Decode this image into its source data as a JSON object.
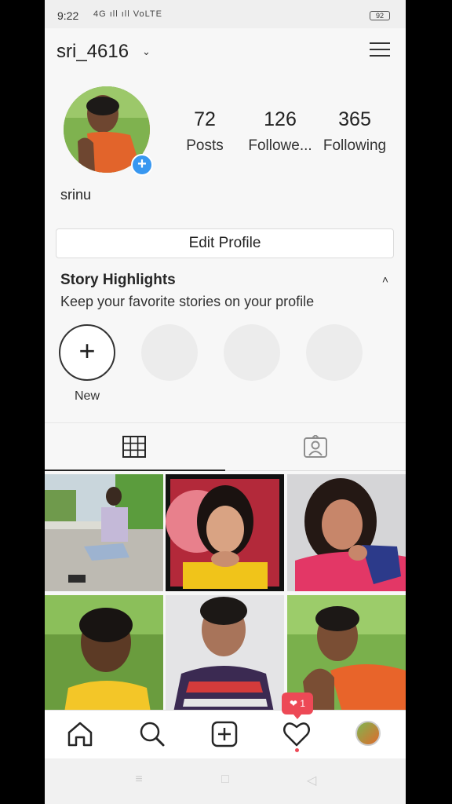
{
  "status_bar": {
    "time": "9:22",
    "signal": "4G ıll ıll VoLTE",
    "battery": "92"
  },
  "header": {
    "username": "sri_4616",
    "dropdown_glyph": "⌄"
  },
  "profile": {
    "stats": [
      {
        "value": "72",
        "label": "Posts"
      },
      {
        "value": "126",
        "label": "Followe..."
      },
      {
        "value": "365",
        "label": "Following"
      }
    ],
    "display_name": "srinu",
    "add_story_glyph": "+"
  },
  "edit_profile": {
    "label": "Edit Profile"
  },
  "story_highlights": {
    "title": "Story Highlights",
    "subtitle": "Keep your favorite stories on your profile",
    "caret": "˄",
    "new_glyph": "+",
    "new_label": "New"
  },
  "tabs": [
    {
      "icon": "grid-icon"
    },
    {
      "icon": "tagged-icon"
    }
  ],
  "bottom_nav": {
    "items": [
      "home-icon",
      "search-icon",
      "add-post-icon",
      "activity-heart-icon",
      "profile-avatar"
    ],
    "notification": {
      "glyph": "❤",
      "count": "1"
    }
  },
  "system_nav": {
    "menu": "≡",
    "home": "□",
    "back": "◁"
  },
  "colors": {
    "accent_blue": "#3897f0",
    "notification_red": "#ed4956"
  }
}
